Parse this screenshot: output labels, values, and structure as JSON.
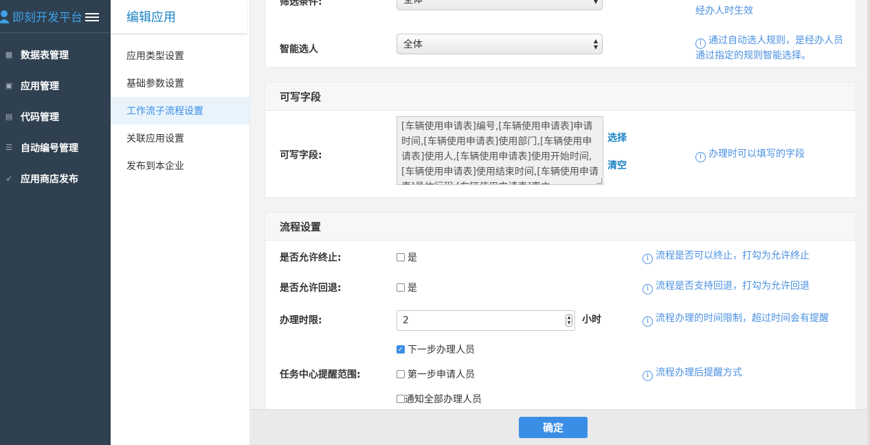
{
  "sidebar": {
    "brand": "即刻开发平台",
    "items": [
      {
        "label": "数据表管理",
        "icon": "calendar-icon"
      },
      {
        "label": "应用管理",
        "icon": "monitor-icon"
      },
      {
        "label": "代码管理",
        "icon": "code-window-icon"
      },
      {
        "label": "自动编号管理",
        "icon": "list-icon"
      },
      {
        "label": "应用商店发布",
        "icon": "rocket-icon"
      }
    ]
  },
  "subnav": {
    "title": "编辑应用",
    "items": [
      {
        "label": "应用类型设置"
      },
      {
        "label": "基础参数设置"
      },
      {
        "label": "工作流子流程设置"
      },
      {
        "label": "关联应用设置"
      },
      {
        "label": "发布到本企业"
      }
    ],
    "active": "工作流子流程设置"
  },
  "select_panel": {
    "filter_label": "筛选条件:",
    "filter_value": "全体",
    "filter_hint_tail": "经办人时生效",
    "smart_label": "智能选人",
    "smart_value": "全体",
    "smart_hint": "通过自动选人规则，是经办人员通过指定的规则智能选择。"
  },
  "writable": {
    "title": "可写字段",
    "label": "可写字段:",
    "value": "[车辆使用申请表]编号,[车辆使用申请表]申请时间,[车辆使用申请表]使用部门,[车辆使用申请表]使用人,[车辆使用申请表]使用开始时间,[车辆使用申请表]使用结束时间,[车辆使用申请表]具体行程,[车辆使用申请表]事由,",
    "select_link": "选择",
    "clear_link": "清空",
    "hint": "办理时可以填写的字段"
  },
  "flow": {
    "title": "流程设置",
    "terminate_label": "是否允许终止:",
    "terminate_option": "是",
    "terminate_checked": false,
    "terminate_hint": "流程是否可以终止，打勾为允许终止",
    "rollback_label": "是否允许回退:",
    "rollback_option": "是",
    "rollback_checked": false,
    "rollback_hint": "流程是否支持回退，打勾为允许回退",
    "deadline_label": "办理时限:",
    "deadline_value": "2",
    "deadline_unit": "小时",
    "deadline_hint": "流程办理的时间限制，超过时间会有提醒",
    "remind_label": "任务中心提醒范围:",
    "remind_options": [
      {
        "label": "下一步办理人员",
        "checked": true
      },
      {
        "label": "第一步申请人员",
        "checked": false
      },
      {
        "label": "通知全部办理人员",
        "checked": false
      }
    ],
    "remind_hint": "流程办理后提醒方式"
  },
  "footer": {
    "confirm": "确定"
  },
  "colors": {
    "sidebar_bg": "#2f4050",
    "accent": "#3a8ee6",
    "hint": "#4a90e2"
  }
}
